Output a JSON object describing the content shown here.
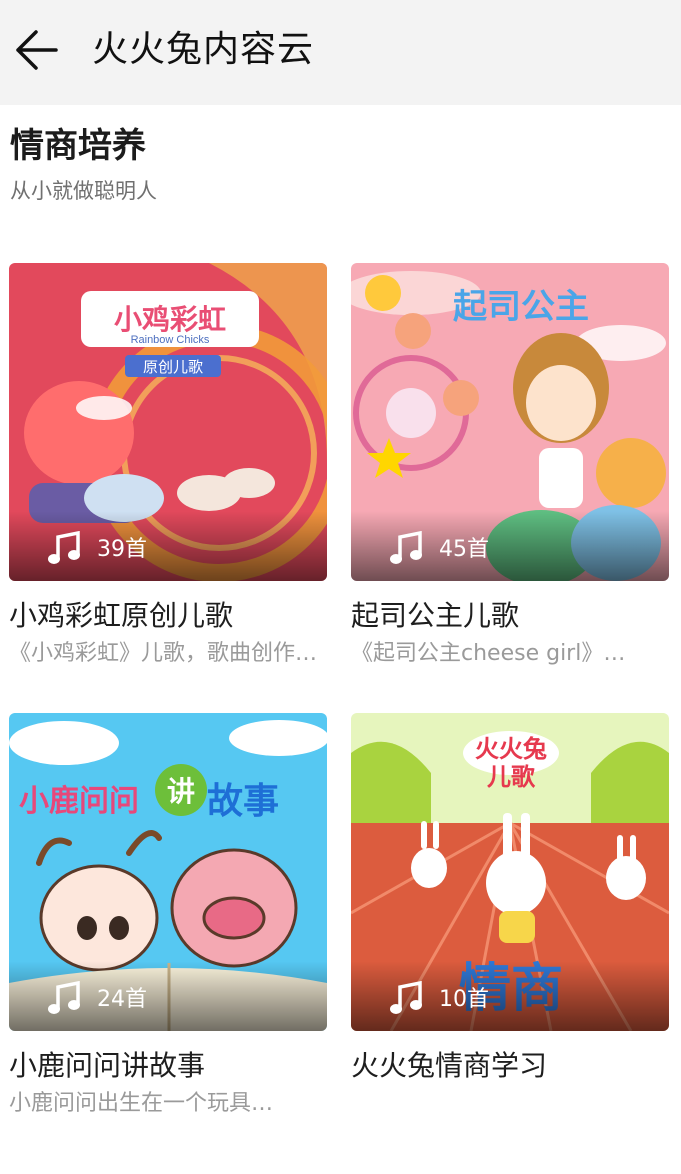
{
  "header": {
    "back_icon": "arrow-left-icon",
    "title": "火火兔内容云"
  },
  "section": {
    "title": "情商培养",
    "subtitle": "从小就做聪明人"
  },
  "albums": [
    {
      "title": "小鸡彩虹原创儿歌",
      "description": "《小鸡彩虹》儿歌，歌曲创作…",
      "count": "39首",
      "cover_colors": [
        "#e2495c",
        "#f7a54a"
      ],
      "cover_logo": "小鸡彩虹",
      "cover_logo_en": "Rainbow Chicks",
      "cover_badge": "原创儿歌"
    },
    {
      "title": "起司公主儿歌",
      "description": "《起司公主cheese girl》…",
      "count": "45首",
      "cover_colors": [
        "#f7a9b4",
        "#fbd6d6"
      ],
      "cover_logo": "起司公主"
    },
    {
      "title": "小鹿问问讲故事",
      "description": "小鹿问问出生在一个玩具…",
      "count": "24首",
      "cover_colors": [
        "#56c8f2",
        "#ffffff"
      ],
      "cover_logo": "小鹿问问",
      "cover_logo_mid": "讲",
      "cover_logo_end": "故事"
    },
    {
      "title": "火火兔情商学习",
      "description": "",
      "count": "10首",
      "cover_colors": [
        "#dc5c3e",
        "#a9d33f"
      ],
      "cover_logo": "火火兔",
      "cover_logo_sub": "儿歌",
      "cover_caption": "情商"
    }
  ]
}
